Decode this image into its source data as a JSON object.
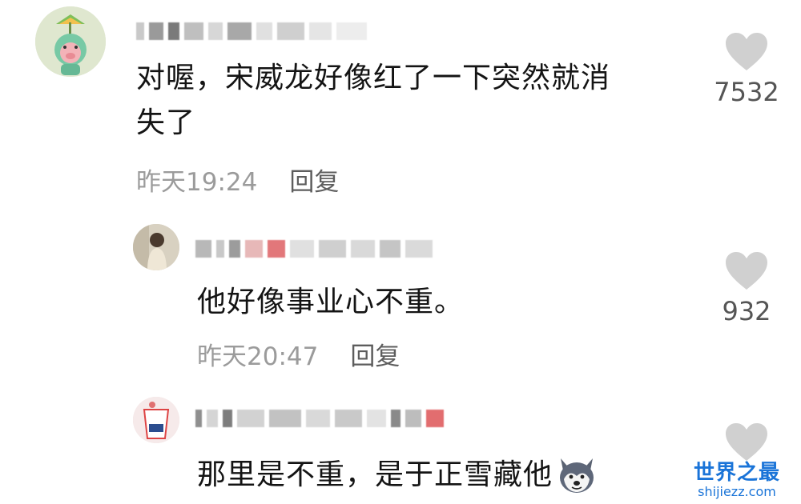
{
  "comments": [
    {
      "text_line1": "对喔，宋威龙好像红了一下突然就消",
      "text_line2": "失了",
      "time": "昨天19:24",
      "reply": "回复",
      "likes": "7532"
    },
    {
      "text": "他好像事业心不重。",
      "time": "昨天20:47",
      "reply": "回复",
      "likes": "932"
    },
    {
      "text": "那里是不重，是于正雪藏他"
    }
  ],
  "watermark": {
    "title": "世界之最",
    "url": "shijiezz.com"
  },
  "icons": {
    "like": "heart-icon",
    "emoji": "husky-dog-emoji-icon"
  },
  "colors": {
    "meta_text": "#9b9b9b",
    "reply_text": "#5d5d5d",
    "heart": "#d0d0d0",
    "watermark": "#1a74d8"
  }
}
